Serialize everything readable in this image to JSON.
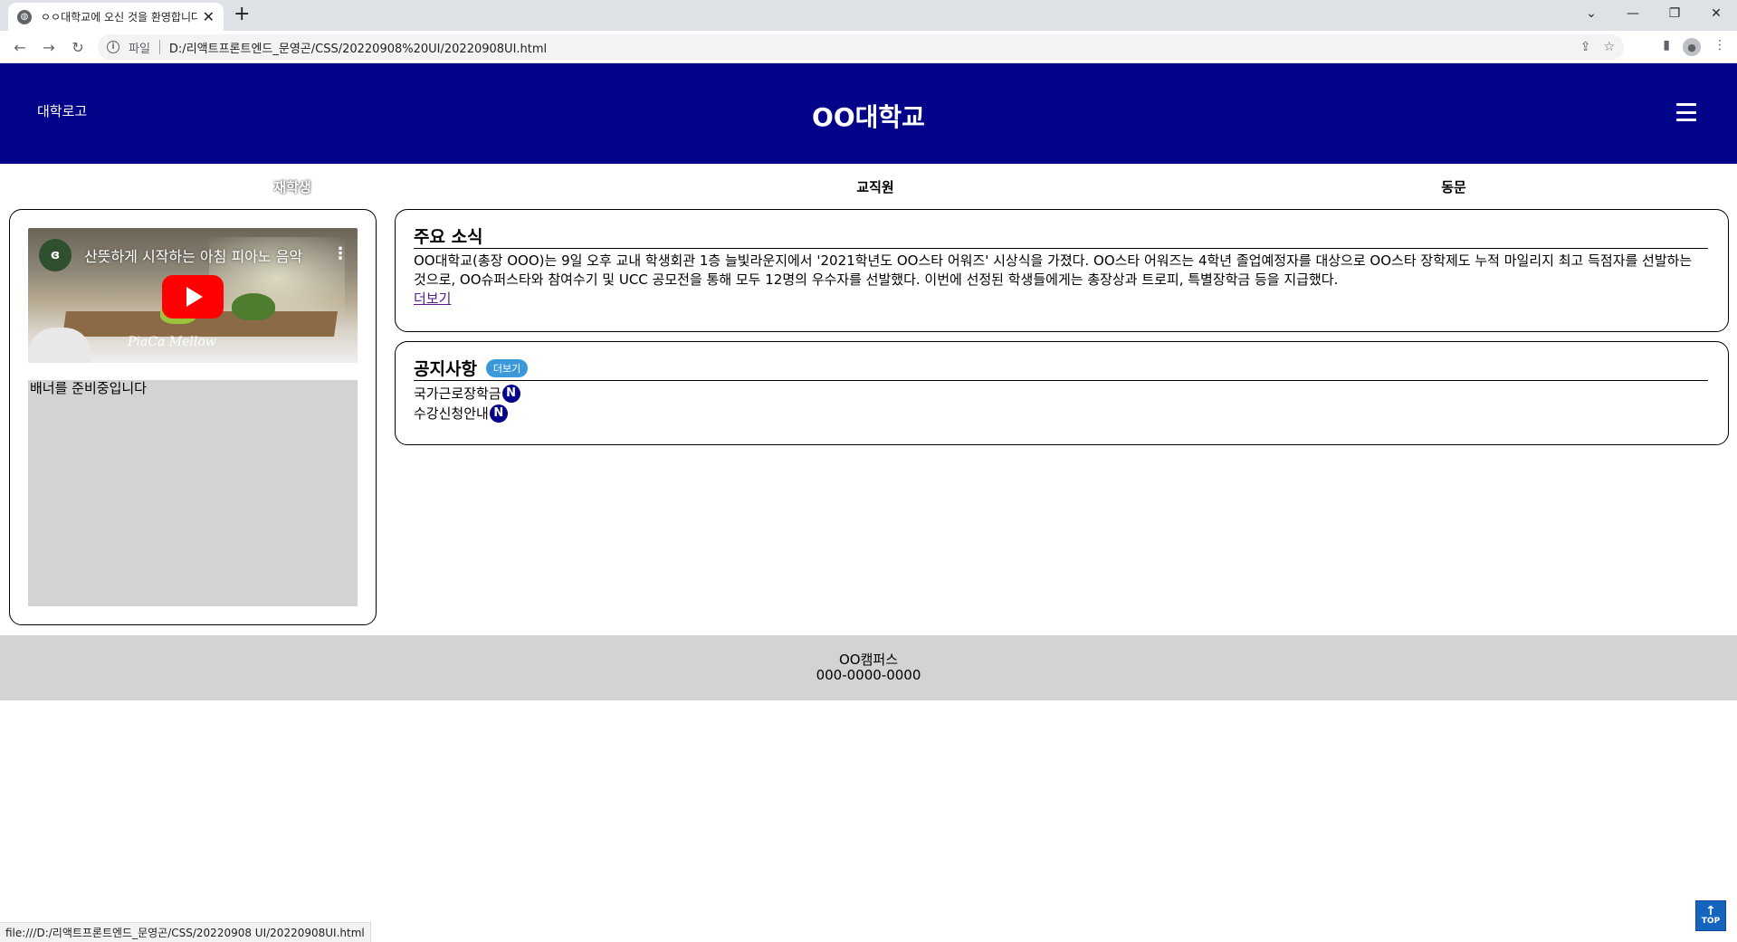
{
  "browser": {
    "tab_title": "ㅇㅇ대학교에 오신 것을 환영합니다",
    "favicon": "globe-icon",
    "file_label": "파일",
    "url": "D:/리액트프론트엔드_문영곤/CSS/20220908%20UI/20220908UI.html",
    "status_url": "file:///D:/리액트프론트엔드_문영곤/CSS/20220908 UI/20220908UI.html"
  },
  "header": {
    "logo": "대학로고",
    "title": "OO대학교",
    "background": "#04048a"
  },
  "nav": {
    "items": [
      {
        "label": "재학생",
        "active": true
      },
      {
        "label": "교직원",
        "active": false
      },
      {
        "label": "동문",
        "active": false
      }
    ]
  },
  "sidebar": {
    "video_title": "산뜻하게 시작하는 아침 피아노 음악",
    "video_signature": "PiaCa Mellow",
    "banner_text": "배너를 준비중입니다"
  },
  "news": {
    "title": "주요 소식",
    "body": "OO대학교(총장 OOO)는 9일 오후 교내 학생회관 1층 늘빛라운지에서 '2021학년도 OO스타 어워즈' 시상식을 가졌다. OO스타 어워즈는 4학년 졸업예정자를 대상으로 OO스타 장학제도 누적 마일리지 최고 득점자를 선발하는 것으로, OO슈퍼스타와 참여수기 및 UCC 공모전을 통해 모두 12명의 우수자를 선발했다. 이번에 선정된 학생들에게는 총장상과 트로피, 특별장학금 등을 지급했다.",
    "more": "더보기"
  },
  "notice": {
    "title": "공지사항",
    "more_badge": "더보기",
    "items": [
      {
        "label": "국가근로장학금",
        "badge": "N"
      },
      {
        "label": "수강신청안내",
        "badge": "N"
      }
    ]
  },
  "footer": {
    "campus": "OO캠퍼스",
    "phone": "000-0000-0000"
  },
  "top_button": "TOP"
}
